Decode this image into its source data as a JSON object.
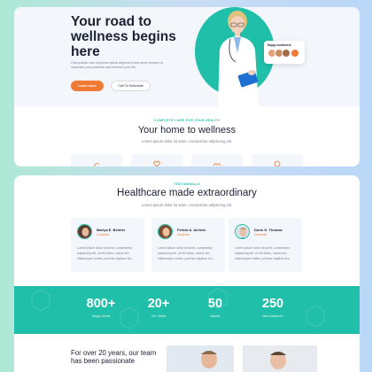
{
  "hero": {
    "title": "Your road to wellness begins here",
    "description": "Chiropractic care improves spinal alignment and nerve function to maximize your potential and enhance your life.",
    "learn_button": "Learn more",
    "schedule_button": "Call To Schedule",
    "happy_label": "Happy customers"
  },
  "wellness": {
    "eyebrow": "COMPLETE CARE FOR YOUR HEALTH",
    "title": "Your home to wellness",
    "subtitle": "Lorem ipsum dolor sit amet, consectetur adipiscing elit."
  },
  "testimonials": {
    "eyebrow": "TESTIMONIALS",
    "title": "Healthcare made extraordinary",
    "subtitle": "Lorem ipsum dolor sit amet, consectetur adipiscing elit.",
    "items": [
      {
        "name": "Mariya E. Beinter",
        "role": "Customer",
        "text": "Lorem ipsum dolor sit amet, consectetur adipiscing elit. Ut elit tellus, luctus nec ullamcorper mattis, pulvinar dapibus leo."
      },
      {
        "name": "Felicia A. Aleleen",
        "role": "Customer",
        "text": "Lorem ipsum dolor sit amet, consectetur adipiscing elit. Ut elit tellus, luctus nec ullamcorper mattis, pulvinar dapibus leo."
      },
      {
        "name": "Doris D. Thomas",
        "role": "Customer",
        "text": "Lorem ipsum dolor sit amet, consectetur adipiscing elit. Ut elit tellus, luctus nec ullamcorper mattis, pulvinar dapibus leo."
      }
    ]
  },
  "stats": [
    {
      "value": "800+",
      "label": "Happy Clients"
    },
    {
      "value": "20+",
      "label": "Our Clinics"
    },
    {
      "value": "50",
      "label": "Awards"
    },
    {
      "value": "250",
      "label": "New Customers"
    }
  ],
  "story": {
    "text": "For over 20 years, our team has been passionate"
  },
  "colors": {
    "accent": "#1fbfa9",
    "cta": "#f07a33",
    "heading": "#1c2233"
  }
}
